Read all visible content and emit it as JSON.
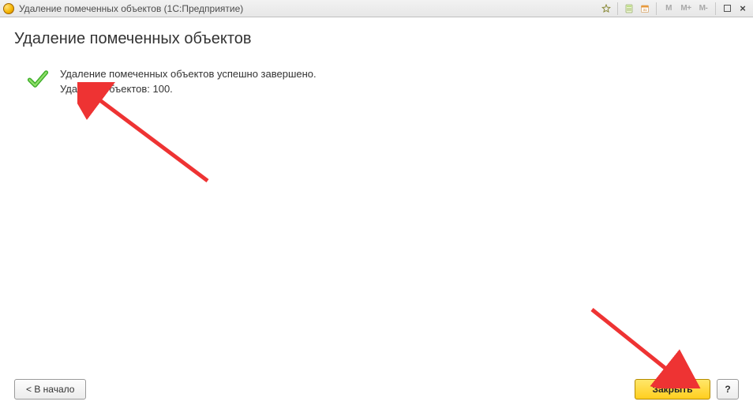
{
  "titlebar": {
    "title": "Удаление помеченных объектов  (1С:Предприятие)",
    "mem": {
      "m": "M",
      "mplus": "M+",
      "mminus": "M-"
    }
  },
  "page": {
    "heading": "Удаление помеченных объектов",
    "result_line1": "Удаление помеченных объектов успешно завершено.",
    "result_line2": "Удалено объектов: 100."
  },
  "buttons": {
    "back": "< В начало",
    "close": "Закрыть",
    "help": "?"
  }
}
